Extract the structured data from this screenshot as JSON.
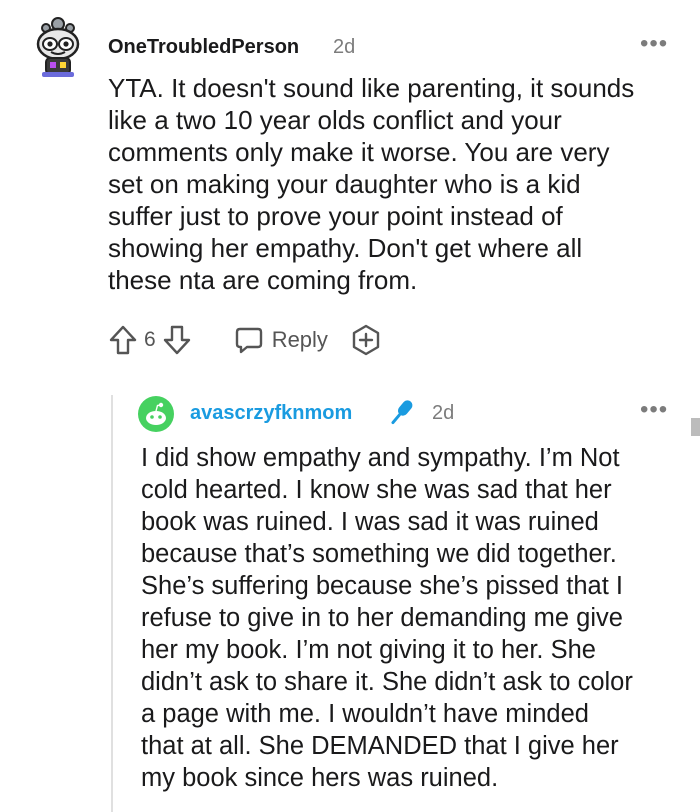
{
  "comment": {
    "username": "OneTroubledPerson",
    "time": "2d",
    "more_icon": "more-options-icon",
    "body_lines": [
      "YTA. It doesn't sound like parenting, it sounds",
      "like a two 10 year olds conflict and your",
      "comments only make it worse. You are very",
      "set on making your daughter who is a kid",
      "suffer just to prove your point instead of",
      "showing her empathy. Don't get where all",
      "these nta are coming from."
    ],
    "vote_count": "6",
    "reply_label": "Reply"
  },
  "reply": {
    "username": "avascrzyfknmom",
    "time": "2d",
    "username_color": "#1a9be0",
    "body_lines": [
      "I did show empathy and sympathy. I’m Not",
      "cold hearted. I know she was sad that her",
      "book was ruined. I was sad it was ruined",
      "because that’s something we did together.",
      "She’s suffering because she’s pissed that I",
      "refuse to give in to her demanding me give",
      "her my book. I’m not giving it to her. She",
      "didn’t ask to share it. She didn’t ask to color",
      "a page with me. I wouldn’t have minded",
      "that at all. She DEMANDED that I give her",
      "my book since hers was ruined."
    ]
  },
  "colors": {
    "meta_gray": "#7c7c7c",
    "text": "#1a1a1b",
    "mic_blue": "#1a9be0",
    "avatar_green": "#46d160"
  }
}
